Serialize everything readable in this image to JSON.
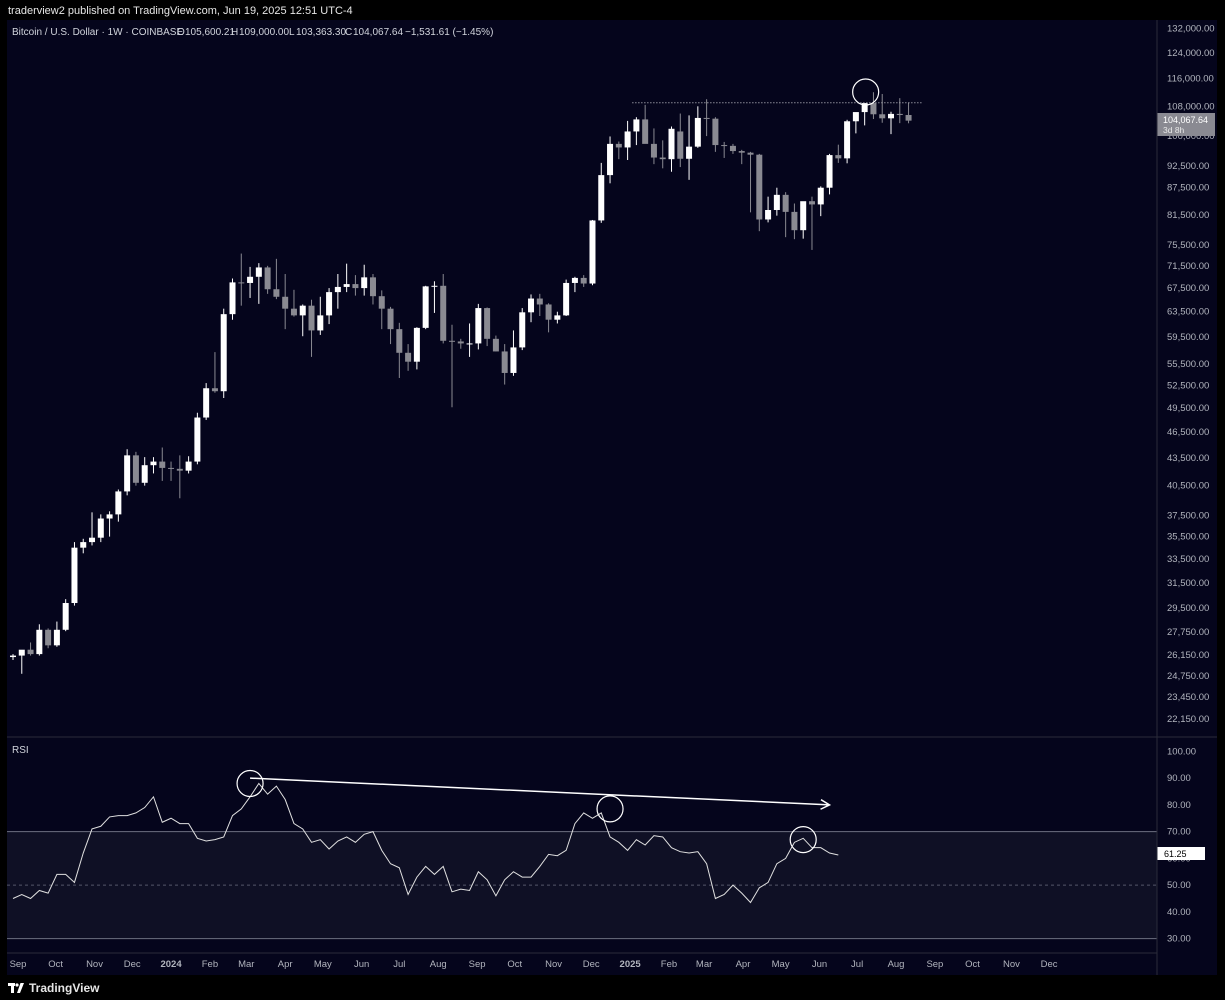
{
  "header": {
    "published": "traderview2 published on TradingView.com, Jun 19, 2025 12:51 UTC-4"
  },
  "legend": {
    "symbol": "Bitcoin / U.S. Dollar · 1W · COINBASE",
    "open_label": "O",
    "open": "105,600.21",
    "high_label": "H",
    "high": "109,000.00",
    "low_label": "L",
    "low": "103,363.30",
    "close_label": "C",
    "close": "104,067.64",
    "change": "−1,531.61 (−1.45%)"
  },
  "price_badge": {
    "price": "104,067.64",
    "countdown": "3d 8h"
  },
  "rsi": {
    "label": "RSI",
    "value": "61.25"
  },
  "footer": {
    "brand": "TradingView"
  },
  "colors": {
    "background": "#05051c",
    "bull": "#ffffff",
    "bear": "#8a8a92",
    "rsi_line": "#e0e0e0",
    "rsi_band": "#0f1025"
  },
  "chart_data": [
    {
      "type": "candlestick",
      "title": "Bitcoin / U.S. Dollar · 1W · COINBASE",
      "yscale": "log",
      "ylim": [
        21200,
        135000
      ],
      "y_ticks": [
        "132,000.00",
        "124,000.00",
        "116,000.00",
        "108,000.00",
        "100,000.00",
        "92,500.00",
        "87,500.00",
        "81,500.00",
        "75,500.00",
        "71,500.00",
        "67,500.00",
        "63,500.00",
        "59,500.00",
        "55,500.00",
        "52,500.00",
        "49,500.00",
        "46,500.00",
        "43,500.00",
        "40,500.00",
        "37,500.00",
        "35,500.00",
        "33,500.00",
        "31,500.00",
        "29,500.00",
        "27,750.00",
        "26,150.00",
        "24,750.00",
        "23,450.00",
        "22,150.00"
      ],
      "x_ticks": [
        "Sep",
        "Oct",
        "Nov",
        "Dec",
        "2024",
        "Feb",
        "Mar",
        "Apr",
        "May",
        "Jun",
        "Jul",
        "Aug",
        "Sep",
        "Oct",
        "Nov",
        "Dec",
        "2025",
        "Feb",
        "Mar",
        "Apr",
        "May",
        "Jun",
        "Jul",
        "Aug",
        "Sep",
        "Oct",
        "Nov",
        "Dec"
      ],
      "first_week": "2023-08-28",
      "reference_line": 109000,
      "series": [
        {
          "candles": [
            [
              26000,
              26200,
              25800,
              26100
            ],
            [
              26100,
              26300,
              24900,
              26500
            ],
            [
              26500,
              27000,
              26100,
              26200
            ],
            [
              26200,
              28300,
              26100,
              27900
            ],
            [
              27900,
              28000,
              26600,
              26800
            ],
            [
              26800,
              28500,
              26700,
              27900
            ],
            [
              27900,
              30200,
              27800,
              29900
            ],
            [
              29900,
              35000,
              29700,
              34500
            ],
            [
              34500,
              35300,
              34000,
              35000
            ],
            [
              35000,
              37800,
              34700,
              35400
            ],
            [
              35400,
              37600,
              35000,
              37200
            ],
            [
              37200,
              37900,
              35500,
              37600
            ],
            [
              37600,
              40100,
              36900,
              39900
            ],
            [
              39900,
              44500,
              39500,
              43800
            ],
            [
              43800,
              44200,
              40500,
              40800
            ],
            [
              40800,
              43600,
              40500,
              42700
            ],
            [
              42700,
              43600,
              41800,
              43100
            ],
            [
              43100,
              44700,
              41000,
              42400
            ],
            [
              42400,
              43100,
              41000,
              42300
            ],
            [
              42300,
              43800,
              39200,
              42100
            ],
            [
              42100,
              43700,
              41800,
              43100
            ],
            [
              43100,
              48900,
              42800,
              48300
            ],
            [
              48300,
              52800,
              48000,
              52100
            ],
            [
              52100,
              57200,
              51500,
              51700
            ],
            [
              51700,
              64000,
              50800,
              63100
            ],
            [
              63100,
              69200,
              62200,
              68500
            ],
            [
              68500,
              73800,
              64500,
              68400
            ],
            [
              68400,
              71300,
              65800,
              69500
            ],
            [
              69500,
              72000,
              64800,
              71200
            ],
            [
              71200,
              71500,
              66500,
              67300
            ],
            [
              67300,
              72800,
              65600,
              66000
            ],
            [
              66000,
              70000,
              60700,
              64000
            ],
            [
              64000,
              67200,
              62700,
              62900
            ],
            [
              62900,
              64700,
              59600,
              64500
            ],
            [
              64500,
              65500,
              56500,
              60500
            ],
            [
              60500,
              66000,
              59800,
              62900
            ],
            [
              62900,
              67500,
              61500,
              66800
            ],
            [
              66800,
              70000,
              64000,
              67700
            ],
            [
              67700,
              71900,
              66800,
              68200
            ],
            [
              68200,
              69800,
              66200,
              67500
            ],
            [
              67500,
              71700,
              66200,
              69400
            ],
            [
              69400,
              70000,
              64700,
              66100
            ],
            [
              66100,
              67100,
              60700,
              64000
            ],
            [
              64000,
              64300,
              58400,
              60700
            ],
            [
              60700,
              61700,
              53500,
              57100
            ],
            [
              57100,
              58400,
              54500,
              55800
            ],
            [
              55800,
              61000,
              54700,
              60900
            ],
            [
              60900,
              67900,
              60700,
              67800
            ],
            [
              67800,
              68700,
              63300,
              67900
            ],
            [
              67900,
              70000,
              58500,
              58900
            ],
            [
              58900,
              61400,
              49600,
              58800
            ],
            [
              58800,
              59200,
              57700,
              58500
            ],
            [
              58500,
              61600,
              56500,
              58500
            ],
            [
              58500,
              64800,
              57600,
              64100
            ],
            [
              64100,
              64200,
              58100,
              59200
            ],
            [
              59200,
              59700,
              57300,
              57300
            ],
            [
              57300,
              58400,
              52600,
              54200
            ],
            [
              54200,
              60500,
              53800,
              57900
            ],
            [
              57900,
              64100,
              57500,
              63400
            ],
            [
              63400,
              66400,
              61800,
              65700
            ],
            [
              65700,
              66500,
              62800,
              64700
            ],
            [
              64700,
              64900,
              60200,
              62200
            ],
            [
              62200,
              63500,
              61600,
              62900
            ],
            [
              62900,
              69000,
              62800,
              68400
            ],
            [
              68400,
              69500,
              66800,
              69300
            ],
            [
              69300,
              69800,
              67700,
              68300
            ],
            [
              68300,
              80500,
              68000,
              80400
            ],
            [
              80400,
              93300,
              79900,
              90400
            ],
            [
              90400,
              99900,
              88500,
              98000
            ],
            [
              98000,
              98600,
              94200,
              97100
            ],
            [
              97100,
              104000,
              94000,
              101200
            ],
            [
              101200,
              105000,
              97700,
              104400
            ],
            [
              104400,
              108400,
              98400,
              98000
            ],
            [
              98000,
              102000,
              93000,
              94600
            ],
            [
              94600,
              98900,
              92000,
              94200
            ],
            [
              94200,
              102500,
              91200,
              101900
            ],
            [
              101200,
              106000,
              92300,
              94300
            ],
            [
              94300,
              105500,
              89300,
              97300
            ],
            [
              97300,
              108000,
              97000,
              104800
            ],
            [
              104800,
              110000,
              100000,
              104600
            ],
            [
              104600,
              105000,
              96000,
              97700
            ],
            [
              97700,
              98500,
              94500,
              97500
            ],
            [
              97500,
              98000,
              95500,
              96200
            ],
            [
              96200,
              96500,
              93000,
              95800
            ],
            [
              95800,
              96000,
              82100,
              95300
            ],
            [
              95300,
              95500,
              78200,
              80600
            ],
            [
              80600,
              85500,
              80000,
              82600
            ],
            [
              82600,
              87500,
              81400,
              85900
            ],
            [
              85900,
              86500,
              77000,
              82200
            ],
            [
              82200,
              84000,
              76600,
              78400
            ],
            [
              78400,
              84200,
              76700,
              84500
            ],
            [
              84500,
              85500,
              74500,
              83800
            ],
            [
              83800,
              87800,
              81300,
              87500
            ],
            [
              87500,
              95500,
              86000,
              95200
            ],
            [
              95200,
              97800,
              93300,
              94400
            ],
            [
              94400,
              104300,
              93200,
              103900
            ],
            [
              103900,
              106000,
              100700,
              106400
            ],
            [
              106400,
              108700,
              102800,
              108900
            ],
            [
              108900,
              112000,
              104500,
              105800
            ],
            [
              105800,
              111500,
              103500,
              104700
            ],
            [
              104700,
              106500,
              100500,
              105900
            ],
            [
              105900,
              110300,
              103400,
              105600
            ],
            [
              105600,
              109000,
              103363.3,
              104067.64
            ]
          ]
        }
      ]
    },
    {
      "type": "line",
      "title": "RSI",
      "ylim": [
        25,
        105
      ],
      "y_ticks": [
        "100.00",
        "90.00",
        "80.00",
        "70.00",
        "60.00",
        "50.00",
        "40.00",
        "30.00"
      ],
      "bands": [
        30,
        50,
        70
      ],
      "series": [
        {
          "values": [
            45,
            46.5,
            45,
            48,
            47,
            54,
            54,
            51,
            62,
            71,
            72,
            75.5,
            76,
            76,
            77,
            79,
            83,
            73.5,
            75,
            73,
            73,
            67.5,
            66.5,
            67,
            68,
            76,
            78.5,
            83,
            88,
            84,
            87,
            82,
            73,
            71,
            66,
            67,
            63.5,
            66.5,
            68,
            66,
            69,
            70,
            63,
            58,
            56.5,
            46.5,
            53,
            57,
            54,
            57,
            47.5,
            48.5,
            48,
            55,
            52,
            46,
            52,
            55,
            53,
            53,
            57,
            61.5,
            61,
            63,
            73,
            77,
            75,
            77,
            68,
            66,
            63,
            67,
            65,
            68.5,
            68,
            64,
            62.5,
            62,
            62.5,
            58,
            45,
            46.5,
            50,
            47,
            43.5,
            49,
            51,
            58,
            60,
            66,
            67.5,
            64,
            64,
            62,
            61.25
          ]
        }
      ],
      "annotations": [
        {
          "type": "arrow",
          "from": [
            "2024-03-04",
            90
          ],
          "to": [
            "2025-06-09",
            80
          ]
        },
        {
          "type": "circle",
          "at": [
            "2024-03-04",
            88
          ]
        },
        {
          "type": "circle",
          "at": [
            "2024-12-16",
            78.5
          ]
        },
        {
          "type": "circle",
          "at": [
            "2025-05-19",
            67
          ]
        }
      ]
    }
  ]
}
